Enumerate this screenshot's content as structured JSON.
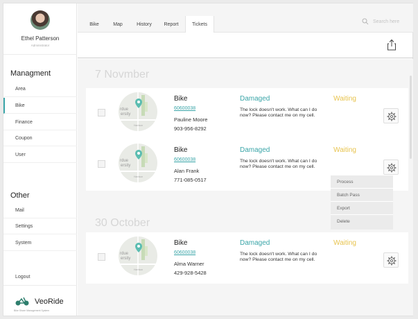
{
  "user": {
    "name": "Ethel Patterson",
    "role": "Administrator"
  },
  "sidebar": {
    "management_title": "Managment",
    "management_items": [
      "Area",
      "Bike",
      "Finance",
      "Coupon",
      "User"
    ],
    "other_title": "Other",
    "other_items": [
      "Mail",
      "Settings",
      "System"
    ],
    "logout": "Logout",
    "active_item": "Bike"
  },
  "brand": {
    "name": "VeoRide",
    "tagline": "Bike Share Management System"
  },
  "tabs": [
    "Bike",
    "Map",
    "History",
    "Report",
    "Tickets"
  ],
  "active_tab": "Tickets",
  "search": {
    "placeholder": "Search here"
  },
  "groups": [
    {
      "date": "7 Novmber"
    },
    {
      "date": "30 October"
    }
  ],
  "tickets": [
    {
      "type": "Bike",
      "id": "60600038",
      "name": "Pauline Moore",
      "phone": "903-956-8292",
      "status": "Damaged",
      "description": "The lock doesn't work. What can I do now? Please contact me on my cell.",
      "state": "Waiting"
    },
    {
      "type": "Bike",
      "id": "60600038",
      "name": "Alan Frank",
      "phone": "771-085-0517",
      "status": "Damaged",
      "description": "The lock doesn't work. What can I do now? Please contact me on my cell.",
      "state": "Waiting"
    },
    {
      "type": "Bike",
      "id": "60600038",
      "name": "Alma Warner",
      "phone": "429-928-5428",
      "status": "Damaged",
      "description": "The lock doesn't work. What can I do now? Please contact me on my cell.",
      "state": "Waiting"
    }
  ],
  "map_labels": {
    "left": "rdue\nersity",
    "street": "Harrison"
  },
  "dropdown": [
    "Process",
    "Batch Pass",
    "Export",
    "Delete"
  ],
  "colors": {
    "accent": "#3aa5a8",
    "waiting": "#e8c44f"
  }
}
